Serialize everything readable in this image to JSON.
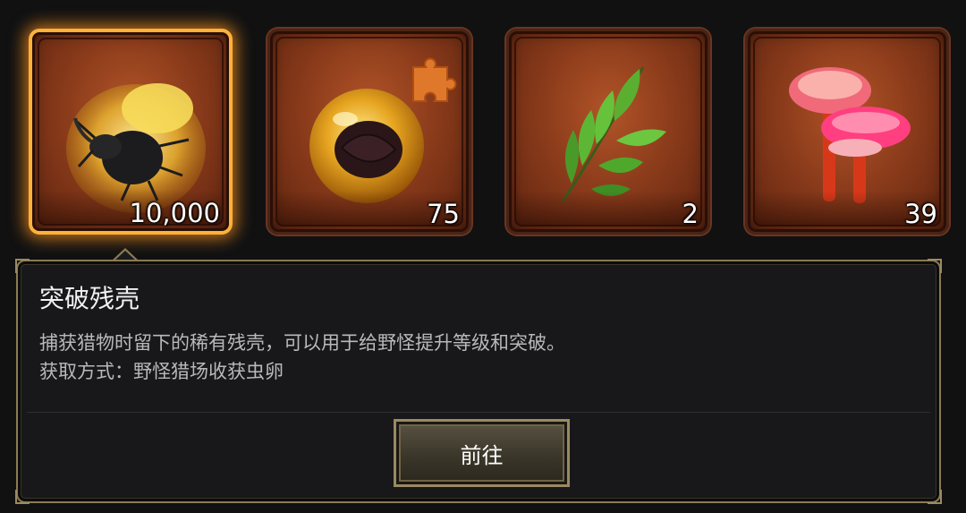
{
  "items": [
    {
      "name": "beetle-in-amber",
      "count": "10,000",
      "selected": true
    },
    {
      "name": "larva-in-amber-piece",
      "count": "75",
      "selected": false
    },
    {
      "name": "green-herb",
      "count": "2",
      "selected": false
    },
    {
      "name": "red-mushroom",
      "count": "39",
      "selected": false
    }
  ],
  "tooltip": {
    "title": "突破残壳",
    "description": "捕获猎物时留下的稀有残壳，可以用于给野怪提升等级和突破。",
    "source": "获取方式：野怪猎场收获虫卵",
    "button_label": "前往"
  },
  "colors": {
    "selection_glow": "#ffb13a",
    "slot_bg": "#8c3c1b",
    "panel_border": "#8a7a55"
  }
}
